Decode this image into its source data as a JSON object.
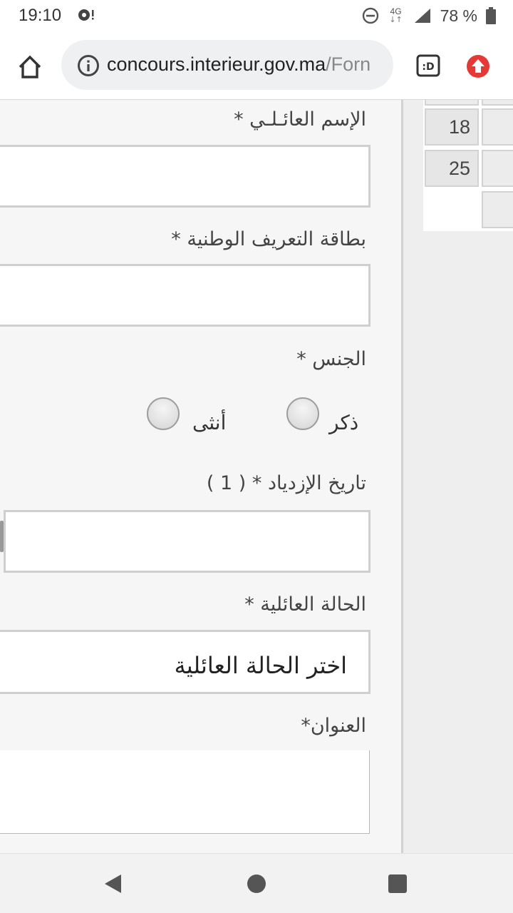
{
  "status_bar": {
    "time": "19:10",
    "network": "4G",
    "battery": "78 %",
    "icons": [
      "notification-icon",
      "dnd-icon",
      "network-icon",
      "signal-icon",
      "battery-icon"
    ]
  },
  "browser": {
    "url_host": "concours.interieur.gov.ma",
    "url_path": "/Forn",
    "icons": [
      "home-icon",
      "info-icon",
      "tab-switcher-icon",
      "update-icon"
    ],
    "accent_color": "#e53935"
  },
  "calendar": {
    "days": [
      "18",
      "25"
    ]
  },
  "form": {
    "family_name_label": "الإسم العائـلـي *",
    "cin_label": "بطاقة التعريف الوطنية *",
    "gender_label": "الجنس *",
    "gender_options": [
      "ذكر",
      "أنثى"
    ],
    "birth_date_label": "تاريخ الإزدياد * ( 1 )",
    "marital_status_label": "الحالة العائلية *",
    "marital_status_value": "اختر الحالة العائلية",
    "address_label": "العنوان*"
  },
  "nav_bar": {
    "icons": [
      "back-icon",
      "home-circle-icon",
      "recents-icon"
    ]
  }
}
